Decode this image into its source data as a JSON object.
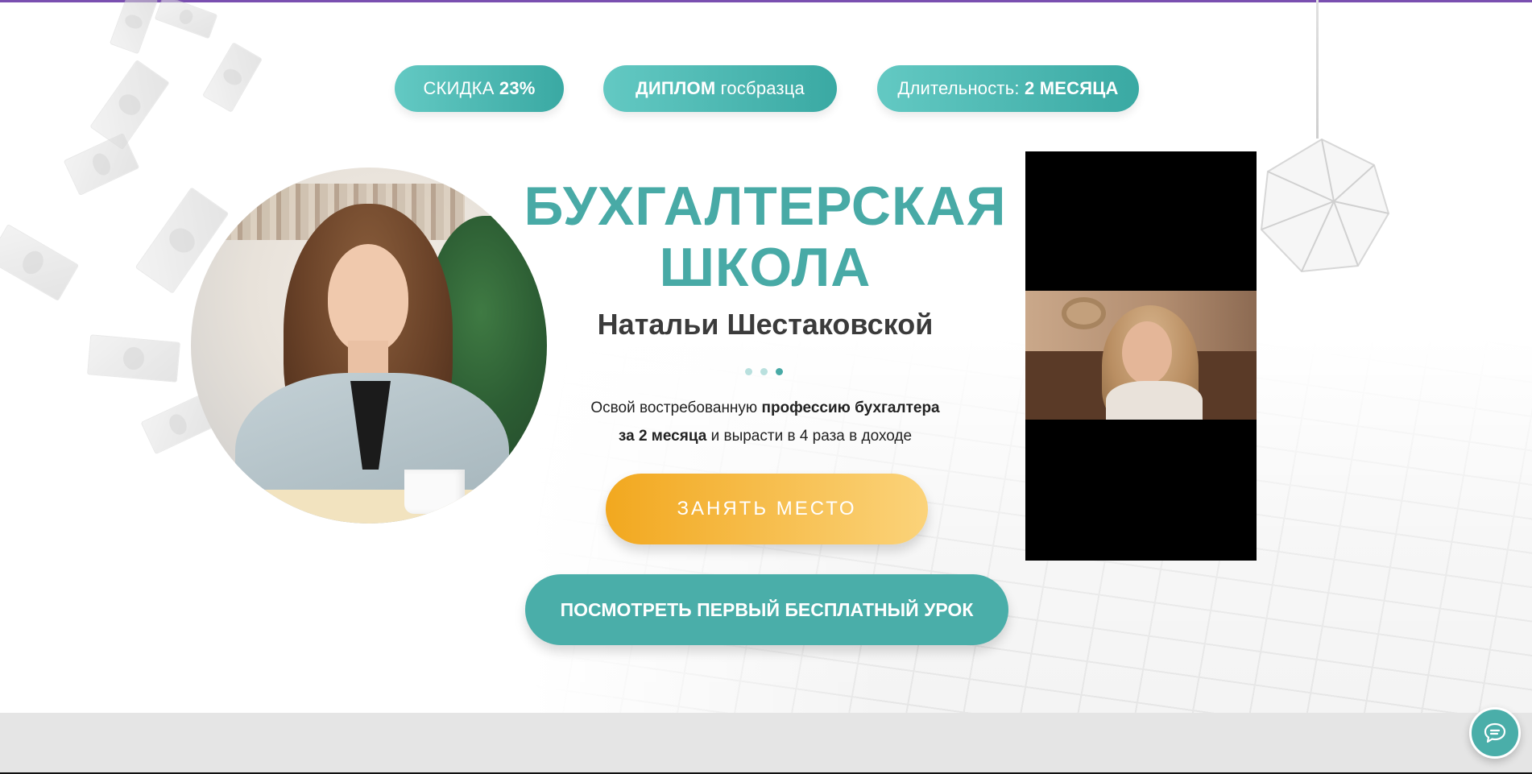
{
  "badges": [
    {
      "prefix": "СКИДКА ",
      "highlight": "23%"
    },
    {
      "prefix": "ДИПЛОМ",
      "suffix": " госбразца"
    },
    {
      "prefix": "Длительность: ",
      "highlight": "2 МЕСЯЦА"
    }
  ],
  "hero": {
    "title_line1": "БУХГАЛТЕРСКАЯ",
    "title_line2": "ШКОЛА",
    "subtitle": "Натальи Шестаковской",
    "desc_part1": "Освой востребованную ",
    "desc_bold1": "профессию бухгалтера",
    "desc_bold2": "за 2 месяца",
    "desc_part2": " и вырасти в 4 раза в доходе"
  },
  "buttons": {
    "primary": "ЗАНЯТЬ МЕСТО",
    "secondary": "ПОСМОТРЕТЬ ПЕРВЫЙ БЕСПЛАТНЫЙ УРОК"
  },
  "slider": {
    "total": 3,
    "active": 3
  },
  "colors": {
    "accent": "#48aaa6",
    "badge_start": "#63c9c3",
    "badge_end": "#3aa9a3",
    "cta_start": "#f2a81f",
    "cta_end": "#fbd37a",
    "top_line": "#7a4fb0"
  },
  "icons": {
    "chat": "chat-bubble-icon"
  }
}
